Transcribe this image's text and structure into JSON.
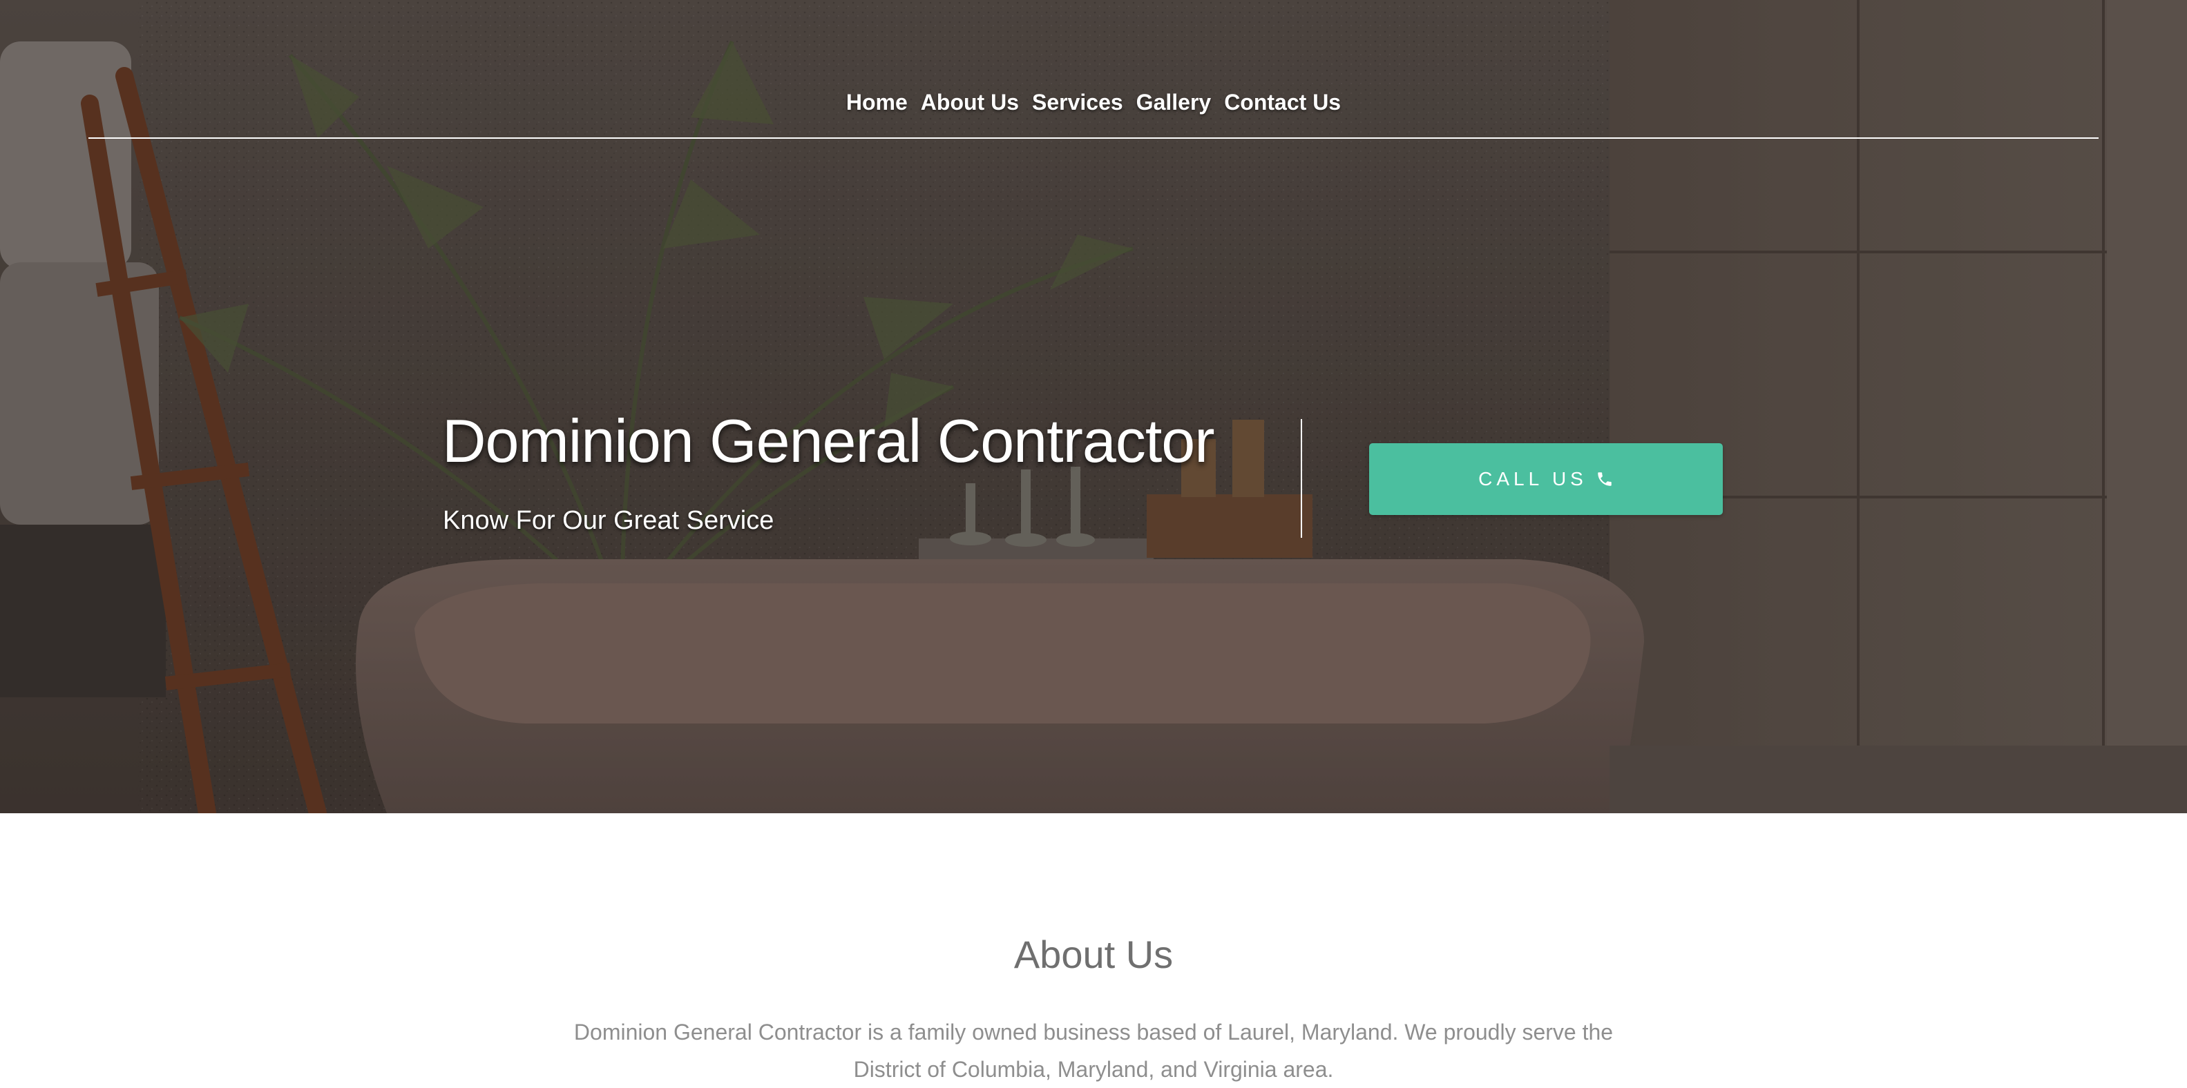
{
  "nav": {
    "items": [
      {
        "label": "Home"
      },
      {
        "label": "About Us"
      },
      {
        "label": "Services"
      },
      {
        "label": "Gallery"
      },
      {
        "label": "Contact Us"
      }
    ]
  },
  "hero": {
    "title": "Dominion General Contractor",
    "subtitle": "Know For Our Great Service",
    "cta_label": "CALL US",
    "cta_icon": "phone-icon",
    "cta_color": "#4bbf9f"
  },
  "about": {
    "title": "About Us",
    "text": "Dominion General Contractor is a family owned business based of Laurel, Maryland. We proudly serve the District of Columbia, Maryland, and Virginia area."
  }
}
